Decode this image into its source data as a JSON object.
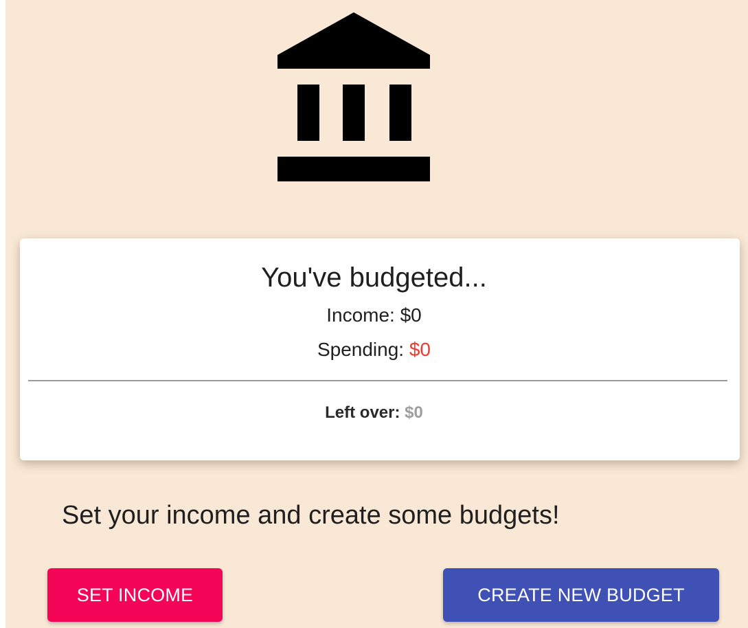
{
  "icon": {
    "name": "bank-icon"
  },
  "summary": {
    "heading": "You've budgeted...",
    "income_label": "Income:",
    "income_value": "$0",
    "spending_label": "Spending:",
    "spending_value": "$0",
    "leftover_label": "Left over:",
    "leftover_value": "$0"
  },
  "prompt": "Set your income and create some budgets!",
  "buttons": {
    "set_income": "SET INCOME",
    "create_budget": "CREATE NEW BUDGET"
  },
  "colors": {
    "background": "#f9e8d6",
    "card": "#ffffff",
    "spending_value": "#f03a2e",
    "leftover_value": "#9e9e9e",
    "set_income_button": "#f50557",
    "create_budget_button": "#3f51b5"
  }
}
